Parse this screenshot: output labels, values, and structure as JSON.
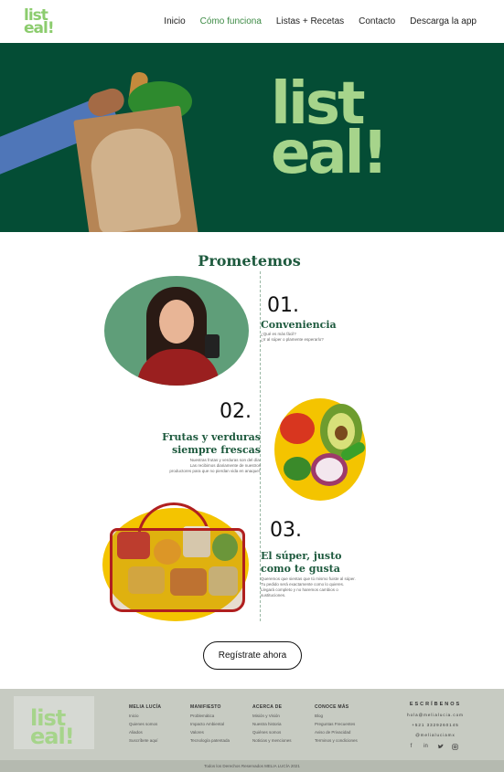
{
  "nav": {
    "logo_line1": "list",
    "logo_line2": "eal!",
    "links": [
      "Inicio",
      "Cómo funciona",
      "Listas + Recetas",
      "Contacto",
      "Descarga la app"
    ],
    "active_color": "#3c8a44"
  },
  "hero": {
    "logo_line1": "list",
    "logo_line2": "eal!",
    "background_color": "#044d35",
    "logo_color": "#a6d48b"
  },
  "promise": {
    "title": "Prometemos",
    "items": [
      {
        "number": "01.",
        "title": "Conveniencia",
        "text": [
          "¿Qué es más fácil?",
          "¿Ir al súper o plamente esperarlo?"
        ]
      },
      {
        "number": "02.",
        "title_line1": "Frutas y verduras",
        "title_line2": "siempre frescas",
        "text": [
          "Nuestras frutas y verduras son del día.",
          "Las recibimos diariamente de nuestros",
          "productores para que no pierdan vida en anaquel."
        ]
      },
      {
        "number": "03.",
        "title_line1": "El súper, justo",
        "title_line2": "como te gusta",
        "text": [
          "Queremos que sientas que tú mismo fuiste al súper.",
          "Tu pedido será exactamente como lo quieres.",
          "Llegará completo y no haremos cambios o",
          "sustituciones."
        ]
      }
    ]
  },
  "cta": {
    "label": "Regístrate ahora"
  },
  "footer": {
    "logo_line1": "list",
    "logo_line2": "eal!",
    "columns": [
      {
        "heading": "MELIA LUCÍA",
        "links": [
          "Inicio",
          "Quienes somos",
          "Aliados",
          "Suscríbete aquí"
        ]
      },
      {
        "heading": "MANIFIESTO",
        "links": [
          "Problemática",
          "Impacto Ambiental",
          "Valores",
          "Tecnología patentada"
        ]
      },
      {
        "heading": "ACERCA DE",
        "links": [
          "Misión y Visión",
          "Nuestra historia",
          "Quiénes somos",
          "Noticias y menciones"
        ]
      },
      {
        "heading": "CONOCE MÁS",
        "links": [
          "Blog",
          "Preguntas Frecuentes",
          "Aviso de Privacidad",
          "Terminos y condiciones"
        ]
      }
    ],
    "contact": {
      "heading": "ESCRÍBENOS",
      "email": "hola@melialucia.com",
      "phone": "+521 3329260145",
      "handle": "@melialuciamx"
    },
    "socials": [
      "facebook-icon",
      "linkedin-icon",
      "twitter-icon",
      "instagram-icon"
    ],
    "copyright": "Todos los Derechos Reservados MELIA LUCÍA 2021"
  }
}
